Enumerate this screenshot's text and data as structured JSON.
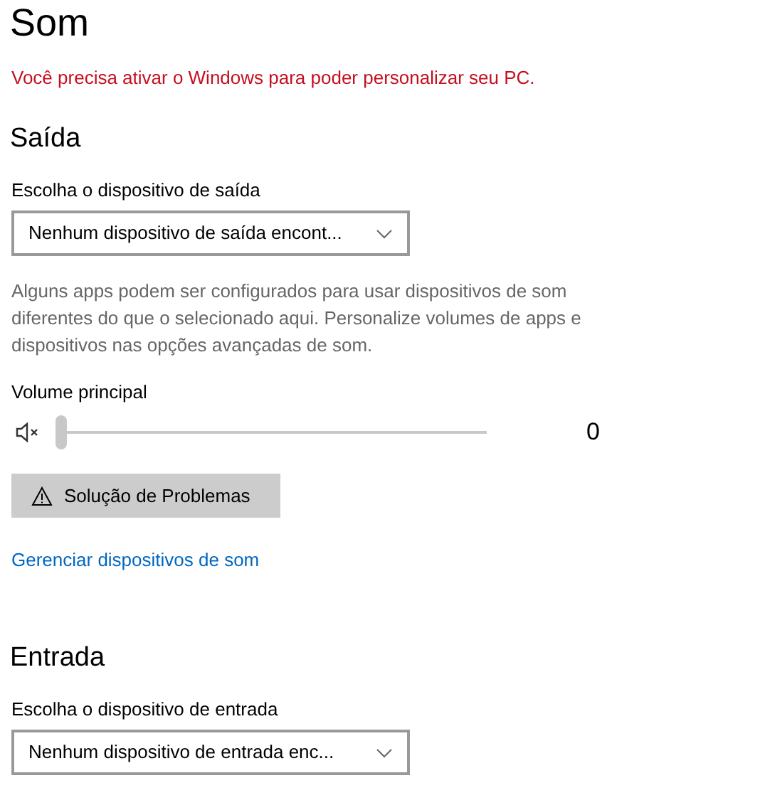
{
  "title": "Som",
  "activation_warning": "Você precisa ativar o Windows para poder personalizar seu PC.",
  "output": {
    "heading": "Saída",
    "device_label": "Escolha o dispositivo de saída",
    "device_value": "Nenhum dispositivo de saída encont...",
    "description": "Alguns apps podem ser configurados para usar dispositivos de som diferentes do que o selecionado aqui. Personalize volumes de apps e dispositivos nas opções avançadas de som.",
    "volume_label": "Volume principal",
    "volume": {
      "muted": true,
      "level": 0,
      "reading": "0"
    },
    "troubleshoot_button": "Solução de Problemas",
    "manage_link": "Gerenciar dispositivos de som"
  },
  "input": {
    "heading": "Entrada",
    "device_label": "Escolha o dispositivo de entrada",
    "device_value": "Nenhum dispositivo de entrada enc..."
  }
}
